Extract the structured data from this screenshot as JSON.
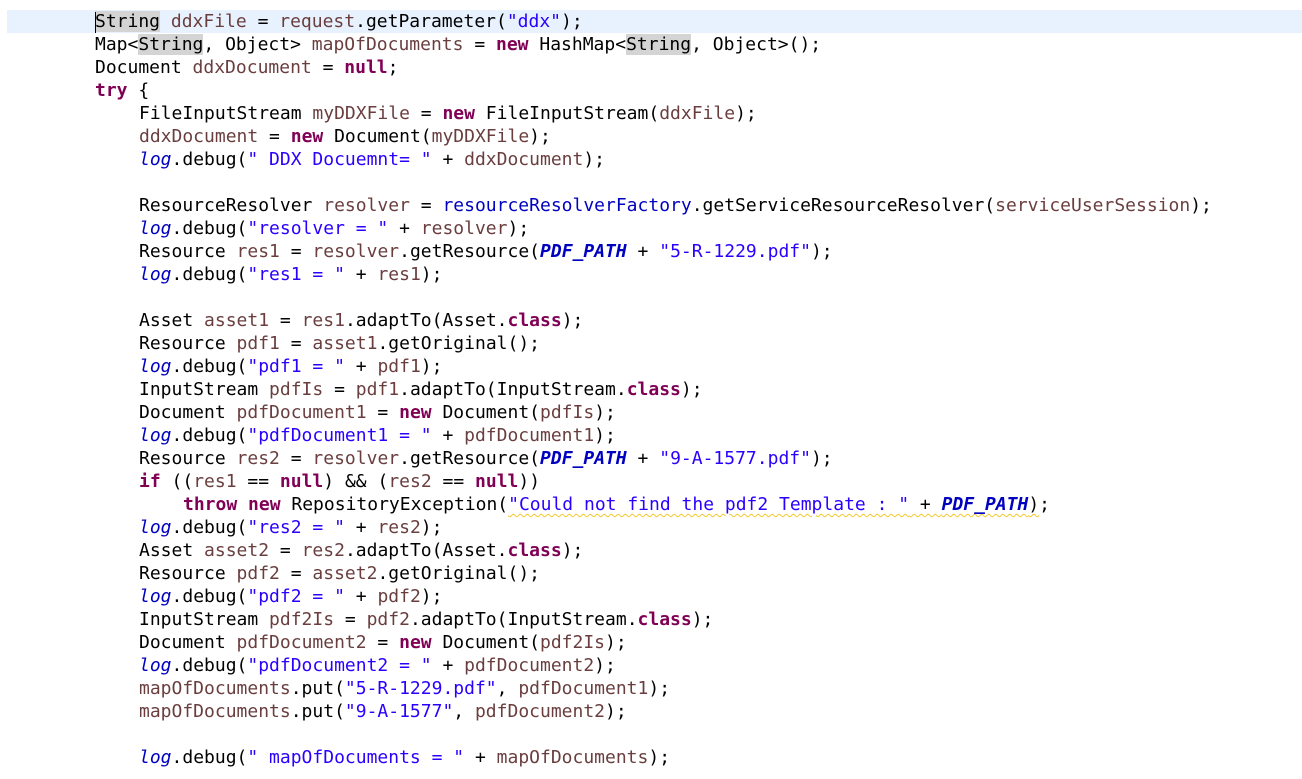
{
  "editor": {
    "language": "java",
    "colors": {
      "keyword": "#7f0055",
      "string": "#2a00ff",
      "local_variable": "#6a3e3e",
      "field": "#0000c0",
      "current_line": "#e8f2fe",
      "occurrence_highlight": "#d4d4d4",
      "warning_underline": "#f4c82d"
    },
    "lines": [
      {
        "indent": 1,
        "tokens": [
          [
            "String",
            "occ"
          ],
          [
            " ",
            ""
          ],
          [
            "ddxFile",
            "local"
          ],
          [
            " = ",
            ""
          ],
          [
            "request",
            "local"
          ],
          [
            ".getParameter(",
            ""
          ],
          [
            "\"ddx\"",
            "string"
          ],
          [
            ");",
            ""
          ]
        ]
      },
      {
        "indent": 1,
        "tokens": [
          [
            "Map<",
            ""
          ],
          [
            "String",
            "occ"
          ],
          [
            ", Object> ",
            ""
          ],
          [
            "mapOfDocuments",
            "local"
          ],
          [
            " = ",
            ""
          ],
          [
            "new",
            "keyword"
          ],
          [
            " HashMap<",
            ""
          ],
          [
            "String",
            "occ"
          ],
          [
            ", Object>();",
            ""
          ]
        ]
      },
      {
        "indent": 1,
        "tokens": [
          [
            "Document ",
            ""
          ],
          [
            "ddxDocument",
            "local"
          ],
          [
            " = ",
            ""
          ],
          [
            "null",
            "keyword"
          ],
          [
            ";",
            ""
          ]
        ]
      },
      {
        "indent": 1,
        "tokens": [
          [
            "try",
            "keyword"
          ],
          [
            " {",
            ""
          ]
        ]
      },
      {
        "indent": 2,
        "tokens": [
          [
            "FileInputStream ",
            ""
          ],
          [
            "myDDXFile",
            "local"
          ],
          [
            " = ",
            ""
          ],
          [
            "new",
            "keyword"
          ],
          [
            " FileInputStream(",
            ""
          ],
          [
            "ddxFile",
            "local"
          ],
          [
            ");",
            ""
          ]
        ]
      },
      {
        "indent": 2,
        "tokens": [
          [
            "ddxDocument",
            "local"
          ],
          [
            " = ",
            ""
          ],
          [
            "new",
            "keyword"
          ],
          [
            " Document(",
            ""
          ],
          [
            "myDDXFile",
            "local"
          ],
          [
            ");",
            ""
          ]
        ]
      },
      {
        "indent": 2,
        "tokens": [
          [
            "log",
            "static"
          ],
          [
            ".debug(",
            ""
          ],
          [
            "\" DDX Docuemnt= \"",
            "string"
          ],
          [
            " + ",
            ""
          ],
          [
            "ddxDocument",
            "local"
          ],
          [
            ");",
            ""
          ]
        ]
      },
      {
        "indent": 0,
        "tokens": []
      },
      {
        "indent": 2,
        "tokens": [
          [
            "ResourceResolver ",
            ""
          ],
          [
            "resolver",
            "local"
          ],
          [
            " = ",
            ""
          ],
          [
            "resourceResolverFactory",
            "field"
          ],
          [
            ".getServiceResourceResolver(",
            ""
          ],
          [
            "serviceUserSession",
            "local"
          ],
          [
            ");",
            ""
          ]
        ]
      },
      {
        "indent": 2,
        "tokens": [
          [
            "log",
            "static"
          ],
          [
            ".debug(",
            ""
          ],
          [
            "\"resolver = \"",
            "string"
          ],
          [
            " + ",
            ""
          ],
          [
            "resolver",
            "local"
          ],
          [
            ");",
            ""
          ]
        ]
      },
      {
        "indent": 2,
        "tokens": [
          [
            "Resource ",
            ""
          ],
          [
            "res1",
            "local"
          ],
          [
            " = ",
            ""
          ],
          [
            "resolver",
            "local"
          ],
          [
            ".getResource(",
            ""
          ],
          [
            "PDF_PATH",
            "const"
          ],
          [
            " + ",
            ""
          ],
          [
            "\"5-R-1229.pdf\"",
            "string"
          ],
          [
            ");",
            ""
          ]
        ]
      },
      {
        "indent": 2,
        "tokens": [
          [
            "log",
            "static"
          ],
          [
            ".debug(",
            ""
          ],
          [
            "\"res1 = \"",
            "string"
          ],
          [
            " + ",
            ""
          ],
          [
            "res1",
            "local"
          ],
          [
            ");",
            ""
          ]
        ]
      },
      {
        "indent": 0,
        "tokens": []
      },
      {
        "indent": 2,
        "tokens": [
          [
            "Asset ",
            ""
          ],
          [
            "asset1",
            "local"
          ],
          [
            " = ",
            ""
          ],
          [
            "res1",
            "local"
          ],
          [
            ".adaptTo(Asset.",
            ""
          ],
          [
            "class",
            "keyword"
          ],
          [
            ");",
            ""
          ]
        ]
      },
      {
        "indent": 2,
        "tokens": [
          [
            "Resource ",
            ""
          ],
          [
            "pdf1",
            "local"
          ],
          [
            " = ",
            ""
          ],
          [
            "asset1",
            "local"
          ],
          [
            ".getOriginal();",
            ""
          ]
        ]
      },
      {
        "indent": 2,
        "tokens": [
          [
            "log",
            "static"
          ],
          [
            ".debug(",
            ""
          ],
          [
            "\"pdf1 = \"",
            "string"
          ],
          [
            " + ",
            ""
          ],
          [
            "pdf1",
            "local"
          ],
          [
            ");",
            ""
          ]
        ]
      },
      {
        "indent": 2,
        "tokens": [
          [
            "InputStream ",
            ""
          ],
          [
            "pdfIs",
            "local"
          ],
          [
            " = ",
            ""
          ],
          [
            "pdf1",
            "local"
          ],
          [
            ".adaptTo(InputStream.",
            ""
          ],
          [
            "class",
            "keyword"
          ],
          [
            ");",
            ""
          ]
        ]
      },
      {
        "indent": 2,
        "tokens": [
          [
            "Document ",
            ""
          ],
          [
            "pdfDocument1",
            "local"
          ],
          [
            " = ",
            ""
          ],
          [
            "new",
            "keyword"
          ],
          [
            " Document(",
            ""
          ],
          [
            "pdfIs",
            "local"
          ],
          [
            ");",
            ""
          ]
        ]
      },
      {
        "indent": 2,
        "tokens": [
          [
            "log",
            "static"
          ],
          [
            ".debug(",
            ""
          ],
          [
            "\"pdfDocument1 = \"",
            "string"
          ],
          [
            " + ",
            ""
          ],
          [
            "pdfDocument1",
            "local"
          ],
          [
            ");",
            ""
          ]
        ]
      },
      {
        "indent": 2,
        "tokens": [
          [
            "Resource ",
            ""
          ],
          [
            "res2",
            "local"
          ],
          [
            " = ",
            ""
          ],
          [
            "resolver",
            "local"
          ],
          [
            ".getResource(",
            ""
          ],
          [
            "PDF_PATH",
            "const"
          ],
          [
            " + ",
            ""
          ],
          [
            "\"9-A-1577.pdf\"",
            "string"
          ],
          [
            ");",
            ""
          ]
        ]
      },
      {
        "indent": 2,
        "tokens": [
          [
            "if",
            "keyword"
          ],
          [
            " ((",
            ""
          ],
          [
            "res1",
            "local"
          ],
          [
            " == ",
            ""
          ],
          [
            "null",
            "keyword"
          ],
          [
            ") && (",
            ""
          ],
          [
            "res2",
            "local"
          ],
          [
            " == ",
            ""
          ],
          [
            "null",
            "keyword"
          ],
          [
            "))",
            ""
          ]
        ]
      },
      {
        "indent": 3,
        "tokens": [
          [
            "throw",
            "keyword"
          ],
          [
            " ",
            ""
          ],
          [
            "new",
            "keyword"
          ],
          [
            " RepositoryException(",
            ""
          ],
          [
            "\"Could not find the pdf2 Template : \"",
            "string-warn"
          ],
          [
            " + ",
            "warn"
          ],
          [
            "PDF_PATH",
            "const-warn"
          ],
          [
            ")",
            "warn"
          ],
          [
            ";",
            ""
          ]
        ]
      },
      {
        "indent": 2,
        "tokens": [
          [
            "log",
            "static"
          ],
          [
            ".debug(",
            ""
          ],
          [
            "\"res2 = \"",
            "string"
          ],
          [
            " + ",
            ""
          ],
          [
            "res2",
            "local"
          ],
          [
            ");",
            ""
          ]
        ]
      },
      {
        "indent": 2,
        "tokens": [
          [
            "Asset ",
            ""
          ],
          [
            "asset2",
            "local"
          ],
          [
            " = ",
            ""
          ],
          [
            "res2",
            "local"
          ],
          [
            ".adaptTo(Asset.",
            ""
          ],
          [
            "class",
            "keyword"
          ],
          [
            ");",
            ""
          ]
        ]
      },
      {
        "indent": 2,
        "tokens": [
          [
            "Resource ",
            ""
          ],
          [
            "pdf2",
            "local"
          ],
          [
            " = ",
            ""
          ],
          [
            "asset2",
            "local"
          ],
          [
            ".getOriginal();",
            ""
          ]
        ]
      },
      {
        "indent": 2,
        "tokens": [
          [
            "log",
            "static"
          ],
          [
            ".debug(",
            ""
          ],
          [
            "\"pdf2 = \"",
            "string"
          ],
          [
            " + ",
            ""
          ],
          [
            "pdf2",
            "local"
          ],
          [
            ");",
            ""
          ]
        ]
      },
      {
        "indent": 2,
        "tokens": [
          [
            "InputStream ",
            ""
          ],
          [
            "pdf2Is",
            "local"
          ],
          [
            " = ",
            ""
          ],
          [
            "pdf2",
            "local"
          ],
          [
            ".adaptTo(InputStream.",
            ""
          ],
          [
            "class",
            "keyword"
          ],
          [
            ");",
            ""
          ]
        ]
      },
      {
        "indent": 2,
        "tokens": [
          [
            "Document ",
            ""
          ],
          [
            "pdfDocument2",
            "local"
          ],
          [
            " = ",
            ""
          ],
          [
            "new",
            "keyword"
          ],
          [
            " Document(",
            ""
          ],
          [
            "pdf2Is",
            "local"
          ],
          [
            ");",
            ""
          ]
        ]
      },
      {
        "indent": 2,
        "tokens": [
          [
            "log",
            "static"
          ],
          [
            ".debug(",
            ""
          ],
          [
            "\"pdfDocument2 = \"",
            "string"
          ],
          [
            " + ",
            ""
          ],
          [
            "pdfDocument2",
            "local"
          ],
          [
            ");",
            ""
          ]
        ]
      },
      {
        "indent": 2,
        "tokens": [
          [
            "mapOfDocuments",
            "local"
          ],
          [
            ".put(",
            ""
          ],
          [
            "\"5-R-1229.pdf\"",
            "string"
          ],
          [
            ", ",
            ""
          ],
          [
            "pdfDocument1",
            "local"
          ],
          [
            ");",
            ""
          ]
        ]
      },
      {
        "indent": 2,
        "tokens": [
          [
            "mapOfDocuments",
            "local"
          ],
          [
            ".put(",
            ""
          ],
          [
            "\"9-A-1577\"",
            "string"
          ],
          [
            ", ",
            ""
          ],
          [
            "pdfDocument2",
            "local"
          ],
          [
            ");",
            ""
          ]
        ]
      },
      {
        "indent": 0,
        "tokens": []
      },
      {
        "indent": 2,
        "tokens": [
          [
            "log",
            "static"
          ],
          [
            ".debug(",
            ""
          ],
          [
            "\" mapOfDocuments = \"",
            "string"
          ],
          [
            " + ",
            ""
          ],
          [
            "mapOfDocuments",
            "local"
          ],
          [
            ");",
            ""
          ]
        ]
      }
    ]
  }
}
